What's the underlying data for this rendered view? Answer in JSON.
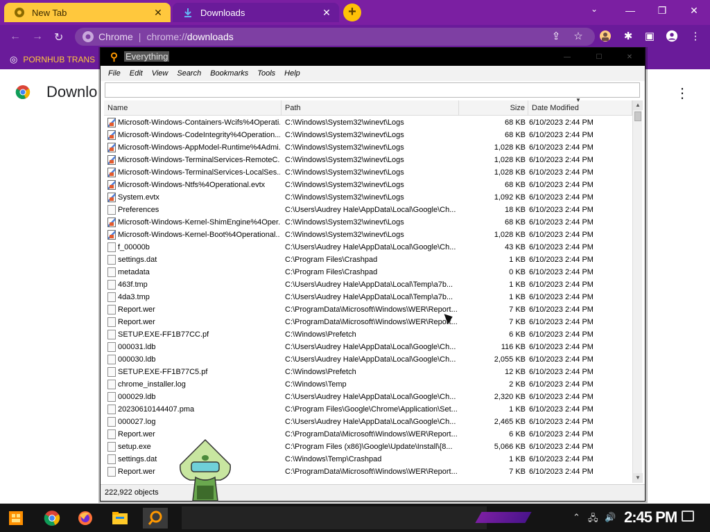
{
  "browser": {
    "tabs": [
      {
        "label": "New Tab",
        "active": false
      },
      {
        "label": "Downloads",
        "active": true
      }
    ],
    "omnibox": {
      "site_name": "Chrome",
      "url_scheme": "chrome://",
      "url_host": "downloads"
    },
    "bookmark": {
      "label": "PORNHUB TRANS"
    },
    "page": {
      "title": "Downlo"
    },
    "colors": {
      "frame": "#6a1b9a",
      "accent": "#ffc83d"
    }
  },
  "everything": {
    "title": "Everything",
    "menu": [
      "File",
      "Edit",
      "View",
      "Search",
      "Bookmarks",
      "Tools",
      "Help"
    ],
    "search_value": "",
    "columns": {
      "name": "Name",
      "path": "Path",
      "size": "Size",
      "date": "Date Modified"
    },
    "rows": [
      {
        "name": "Microsoft-Windows-Containers-Wcifs%4Operati...",
        "path": "C:\\Windows\\System32\\winevt\\Logs",
        "size": "68 KB",
        "date": "6/10/2023 2:44 PM",
        "icon": "log"
      },
      {
        "name": "Microsoft-Windows-CodeIntegrity%4Operation...",
        "path": "C:\\Windows\\System32\\winevt\\Logs",
        "size": "68 KB",
        "date": "6/10/2023 2:44 PM",
        "icon": "log"
      },
      {
        "name": "Microsoft-Windows-AppModel-Runtime%4Admi...",
        "path": "C:\\Windows\\System32\\winevt\\Logs",
        "size": "1,028 KB",
        "date": "6/10/2023 2:44 PM",
        "icon": "log"
      },
      {
        "name": "Microsoft-Windows-TerminalServices-RemoteC...",
        "path": "C:\\Windows\\System32\\winevt\\Logs",
        "size": "1,028 KB",
        "date": "6/10/2023 2:44 PM",
        "icon": "log"
      },
      {
        "name": "Microsoft-Windows-TerminalServices-LocalSes...",
        "path": "C:\\Windows\\System32\\winevt\\Logs",
        "size": "1,028 KB",
        "date": "6/10/2023 2:44 PM",
        "icon": "log"
      },
      {
        "name": "Microsoft-Windows-Ntfs%4Operational.evtx",
        "path": "C:\\Windows\\System32\\winevt\\Logs",
        "size": "68 KB",
        "date": "6/10/2023 2:44 PM",
        "icon": "log"
      },
      {
        "name": "System.evtx",
        "path": "C:\\Windows\\System32\\winevt\\Logs",
        "size": "1,092 KB",
        "date": "6/10/2023 2:44 PM",
        "icon": "log"
      },
      {
        "name": "Preferences",
        "path": "C:\\Users\\Audrey Hale\\AppData\\Local\\Google\\Ch...",
        "size": "18 KB",
        "date": "6/10/2023 2:44 PM",
        "icon": "file"
      },
      {
        "name": "Microsoft-Windows-Kernel-ShimEngine%4Oper...",
        "path": "C:\\Windows\\System32\\winevt\\Logs",
        "size": "68 KB",
        "date": "6/10/2023 2:44 PM",
        "icon": "log"
      },
      {
        "name": "Microsoft-Windows-Kernel-Boot%4Operational...",
        "path": "C:\\Windows\\System32\\winevt\\Logs",
        "size": "1,028 KB",
        "date": "6/10/2023 2:44 PM",
        "icon": "log"
      },
      {
        "name": "f_00000b",
        "path": "C:\\Users\\Audrey Hale\\AppData\\Local\\Google\\Ch...",
        "size": "43 KB",
        "date": "6/10/2023 2:44 PM",
        "icon": "file"
      },
      {
        "name": "settings.dat",
        "path": "C:\\Program Files\\Crashpad",
        "size": "1 KB",
        "date": "6/10/2023 2:44 PM",
        "icon": "file"
      },
      {
        "name": "metadata",
        "path": "C:\\Program Files\\Crashpad",
        "size": "0 KB",
        "date": "6/10/2023 2:44 PM",
        "icon": "file"
      },
      {
        "name": "463f.tmp",
        "path": "C:\\Users\\Audrey Hale\\AppData\\Local\\Temp\\a7b...",
        "size": "1 KB",
        "date": "6/10/2023 2:44 PM",
        "icon": "file"
      },
      {
        "name": "4da3.tmp",
        "path": "C:\\Users\\Audrey Hale\\AppData\\Local\\Temp\\a7b...",
        "size": "1 KB",
        "date": "6/10/2023 2:44 PM",
        "icon": "file"
      },
      {
        "name": "Report.wer",
        "path": "C:\\ProgramData\\Microsoft\\Windows\\WER\\Report...",
        "size": "7 KB",
        "date": "6/10/2023 2:44 PM",
        "icon": "file"
      },
      {
        "name": "Report.wer",
        "path": "C:\\ProgramData\\Microsoft\\Windows\\WER\\Report...",
        "size": "7 KB",
        "date": "6/10/2023 2:44 PM",
        "icon": "file"
      },
      {
        "name": "SETUP.EXE-FF1B77CC.pf",
        "path": "C:\\Windows\\Prefetch",
        "size": "6 KB",
        "date": "6/10/2023 2:44 PM",
        "icon": "file"
      },
      {
        "name": "000031.ldb",
        "path": "C:\\Users\\Audrey Hale\\AppData\\Local\\Google\\Ch...",
        "size": "116 KB",
        "date": "6/10/2023 2:44 PM",
        "icon": "file"
      },
      {
        "name": "000030.ldb",
        "path": "C:\\Users\\Audrey Hale\\AppData\\Local\\Google\\Ch...",
        "size": "2,055 KB",
        "date": "6/10/2023 2:44 PM",
        "icon": "file"
      },
      {
        "name": "SETUP.EXE-FF1B77C5.pf",
        "path": "C:\\Windows\\Prefetch",
        "size": "12 KB",
        "date": "6/10/2023 2:44 PM",
        "icon": "file"
      },
      {
        "name": "chrome_installer.log",
        "path": "C:\\Windows\\Temp",
        "size": "2 KB",
        "date": "6/10/2023 2:44 PM",
        "icon": "file"
      },
      {
        "name": "000029.ldb",
        "path": "C:\\Users\\Audrey Hale\\AppData\\Local\\Google\\Ch...",
        "size": "2,320 KB",
        "date": "6/10/2023 2:44 PM",
        "icon": "file"
      },
      {
        "name": "20230610144407.pma",
        "path": "C:\\Program Files\\Google\\Chrome\\Application\\Set...",
        "size": "1 KB",
        "date": "6/10/2023 2:44 PM",
        "icon": "file"
      },
      {
        "name": "000027.log",
        "path": "C:\\Users\\Audrey Hale\\AppData\\Local\\Google\\Ch...",
        "size": "2,465 KB",
        "date": "6/10/2023 2:44 PM",
        "icon": "file"
      },
      {
        "name": "Report.wer",
        "path": "C:\\ProgramData\\Microsoft\\Windows\\WER\\Report...",
        "size": "6 KB",
        "date": "6/10/2023 2:44 PM",
        "icon": "file"
      },
      {
        "name": "setup.exe",
        "path": "C:\\Program Files (x86)\\Google\\Update\\Install\\{8...",
        "size": "5,066 KB",
        "date": "6/10/2023 2:44 PM",
        "icon": "file"
      },
      {
        "name": "settings.dat",
        "path": "C:\\Windows\\Temp\\Crashpad",
        "size": "1 KB",
        "date": "6/10/2023 2:44 PM",
        "icon": "file"
      },
      {
        "name": "Report.wer",
        "path": "C:\\ProgramData\\Microsoft\\Windows\\WER\\Report...",
        "size": "7 KB",
        "date": "6/10/2023 2:44 PM",
        "icon": "file"
      }
    ],
    "status": "222,922 objects"
  },
  "taskbar": {
    "apps": [
      "start-icon",
      "chrome-icon",
      "firefox-icon",
      "file-explorer-icon",
      "everything-icon"
    ],
    "clock": "2:45 PM"
  }
}
